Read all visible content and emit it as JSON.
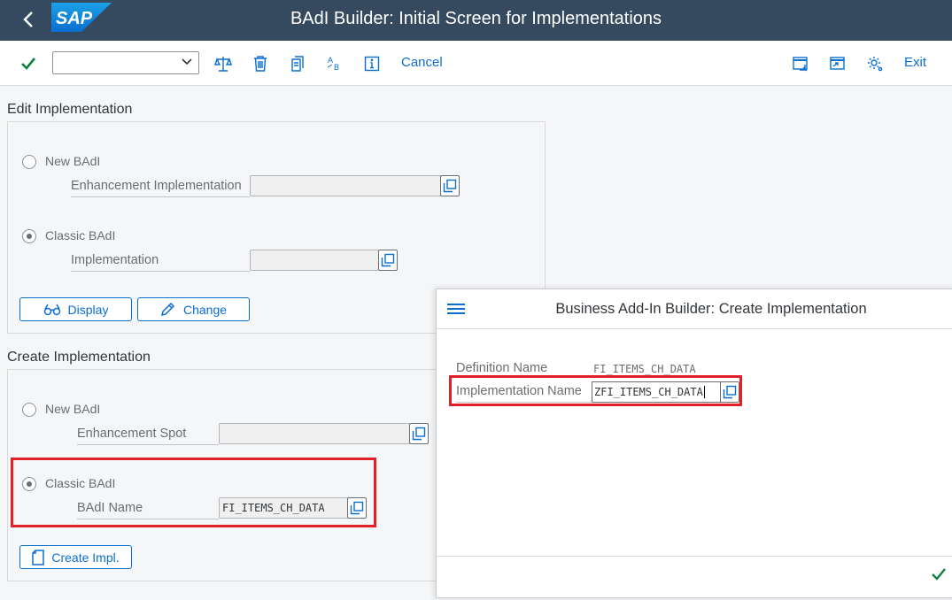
{
  "app": {
    "logo_text": "SAP",
    "title": "BAdI Builder: Initial Screen for Implementations"
  },
  "toolbar": {
    "cancel_label": "Cancel",
    "exit_label": "Exit",
    "command_field_value": ""
  },
  "edit_section": {
    "title": "Edit Implementation",
    "new_badi_label": "New BAdI",
    "enh_impl_label": "Enhancement Implementation",
    "enh_impl_value": "",
    "classic_badi_label": "Classic BAdI",
    "impl_label": "Implementation",
    "impl_value": "",
    "display_label": "Display",
    "change_label": "Change",
    "selected": "classic"
  },
  "create_section": {
    "title": "Create Implementation",
    "new_badi_label": "New BAdI",
    "enh_spot_label": "Enhancement Spot",
    "enh_spot_value": "",
    "classic_badi_label": "Classic BAdI",
    "badi_name_label": "BAdI Name",
    "badi_name_value": "FI_ITEMS_CH_DATA",
    "create_label": "Create Impl.",
    "selected": "classic"
  },
  "dialog": {
    "title": "Business Add-In Builder: Create Implementation",
    "def_name_label": "Definition Name",
    "def_name_value": "FI_ITEMS_CH_DATA",
    "impl_name_label": "Implementation Name",
    "impl_name_value": "ZFI_ITEMS_CH_DATA"
  },
  "colors": {
    "shell": "#354a5f",
    "accent": "#0a6ed1",
    "highlight": "#e3202a",
    "confirm": "#107e3e"
  }
}
